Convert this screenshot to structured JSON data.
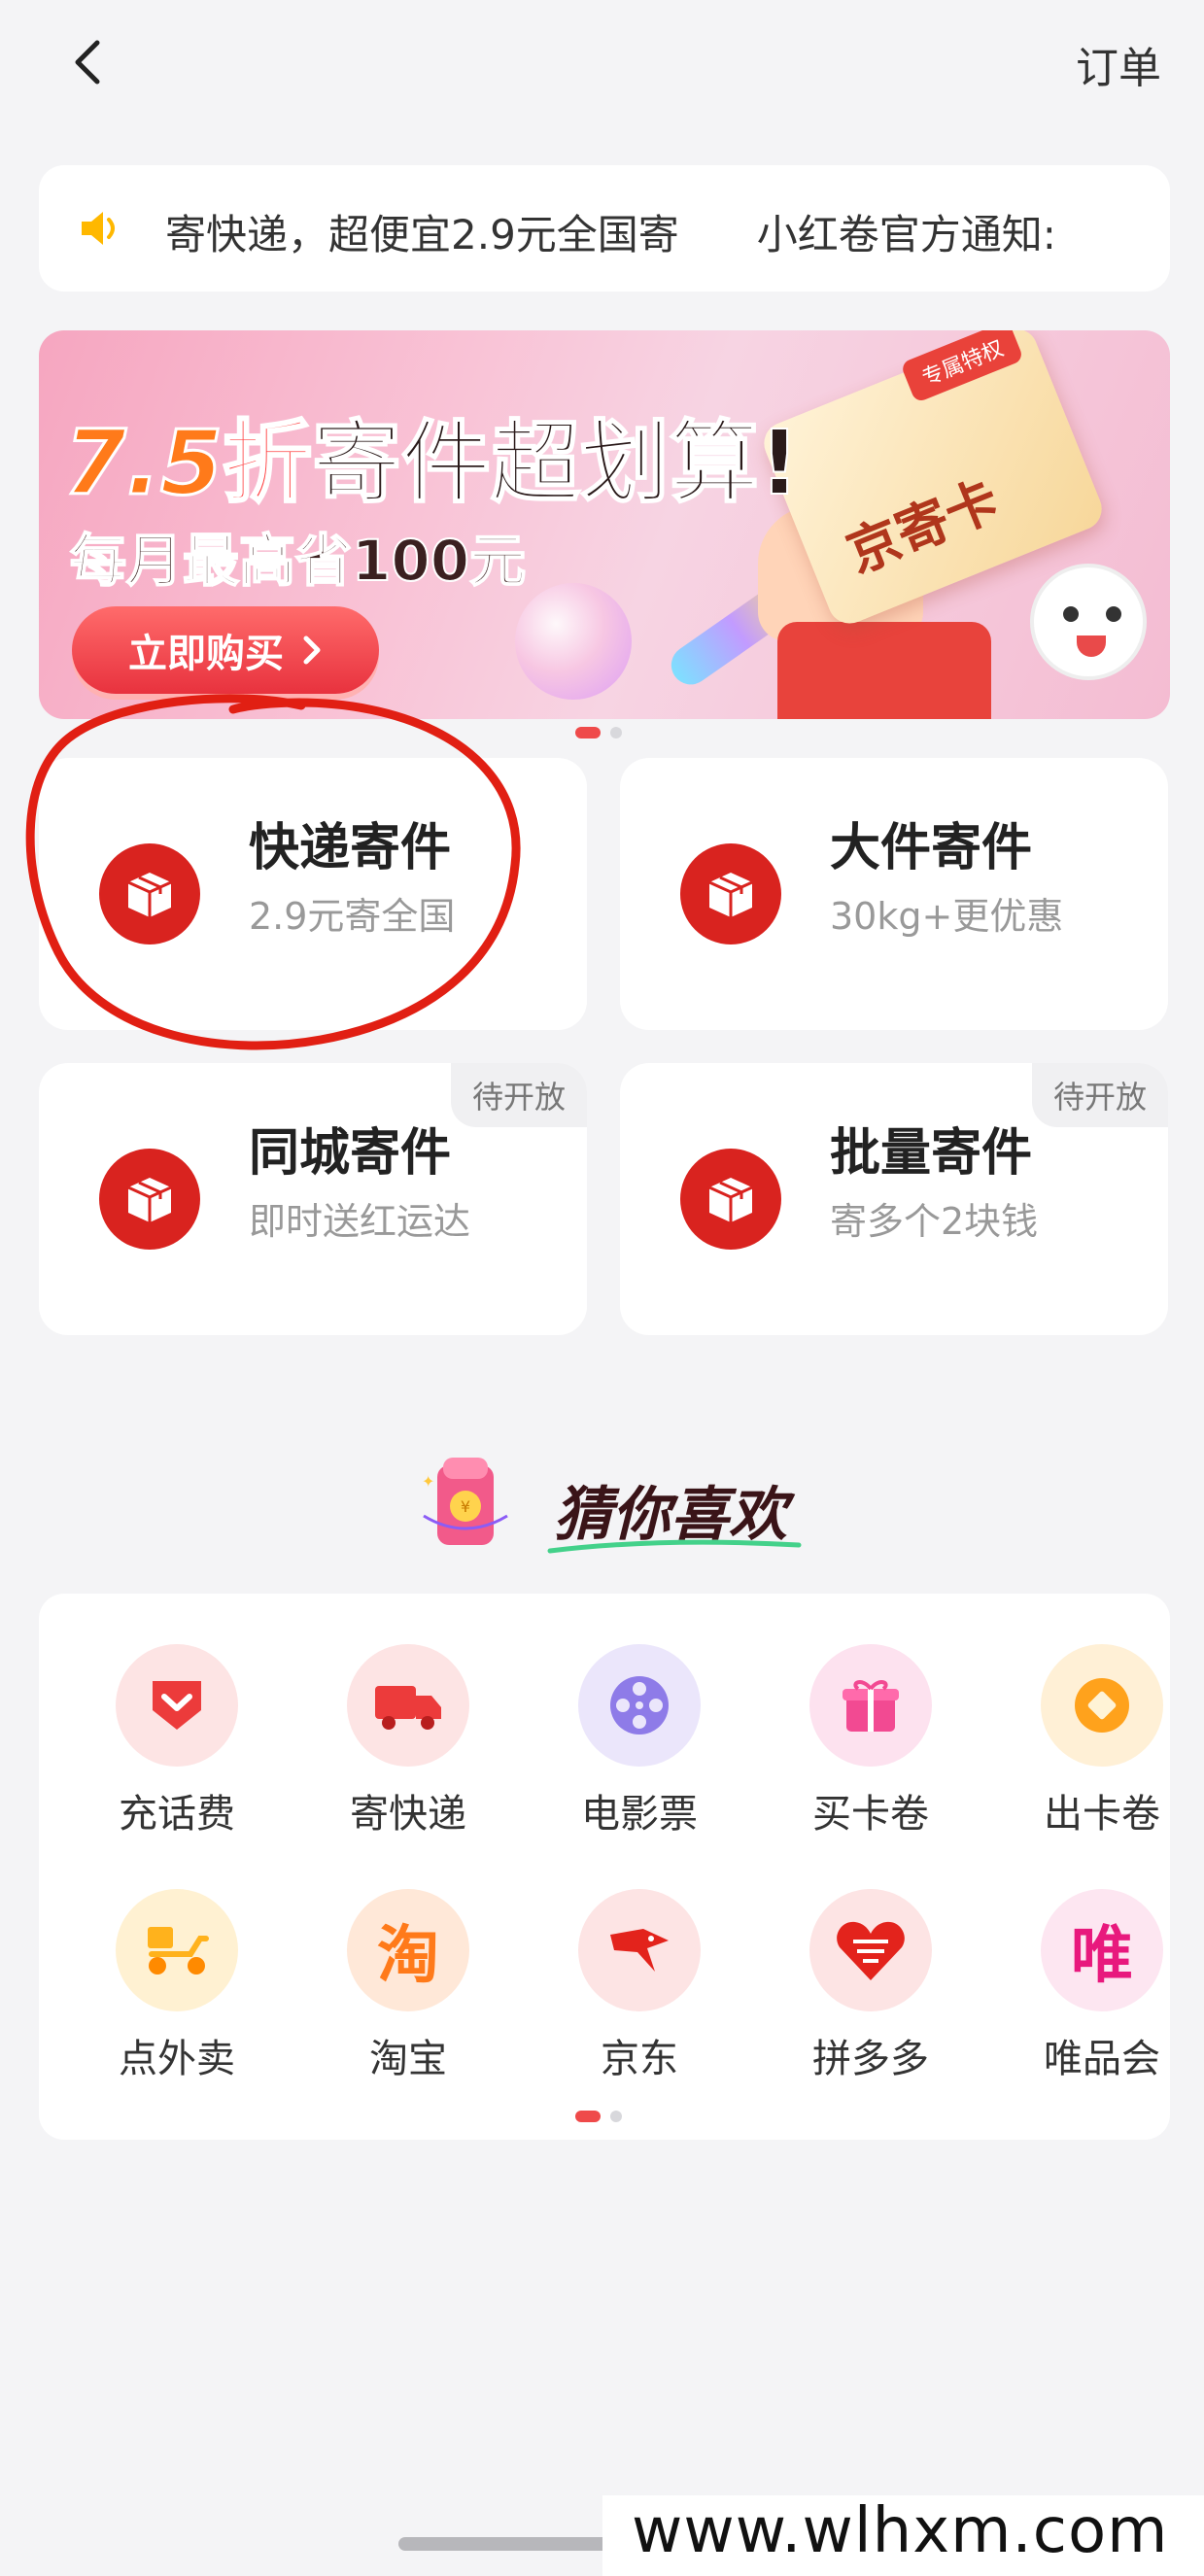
{
  "header": {
    "orders_label": "订单"
  },
  "notice": {
    "text_1": "寄快递，超便宜2.9元全国寄",
    "text_2": "小红卷官方通知:"
  },
  "banner": {
    "discount_number": "7.5",
    "discount_word": "折",
    "headline_rest": "寄件超划算!",
    "subtitle": "每月最高省100元",
    "buy_label": "立即购买",
    "card_tag": "专属特权",
    "card_name": "京寄卡"
  },
  "services": [
    {
      "title": "快递寄件",
      "subtitle": "2.9元寄全国",
      "badge": ""
    },
    {
      "title": "大件寄件",
      "subtitle": "30kg+更优惠",
      "badge": ""
    },
    {
      "title": "同城寄件",
      "subtitle": "即时送红运达",
      "badge": "待开放"
    },
    {
      "title": "批量寄件",
      "subtitle": "寄多个2块钱",
      "badge": "待开放"
    }
  ],
  "recommend": {
    "title": "猜你喜欢",
    "items": [
      {
        "label": "充话费",
        "icon": "heart-shield-icon",
        "glyph": "♥"
      },
      {
        "label": "寄快递",
        "icon": "truck-icon",
        "glyph": ""
      },
      {
        "label": "电影票",
        "icon": "film-reel-icon",
        "glyph": ""
      },
      {
        "label": "买卡卷",
        "icon": "gift-icon",
        "glyph": ""
      },
      {
        "label": "出卡卷",
        "icon": "coin-icon",
        "glyph": ""
      },
      {
        "label": "点外卖",
        "icon": "scooter-icon",
        "glyph": ""
      },
      {
        "label": "淘宝",
        "icon": "taobao-icon",
        "glyph": "淘"
      },
      {
        "label": "京东",
        "icon": "jd-icon",
        "glyph": ""
      },
      {
        "label": "拼多多",
        "icon": "pinduoduo-icon",
        "glyph": ""
      },
      {
        "label": "唯品会",
        "icon": "vip-icon",
        "glyph": "唯"
      }
    ]
  },
  "watermark": "www.wlhxm.com",
  "colors": {
    "accent": "#d9231f",
    "background": "#f4f4f6"
  }
}
